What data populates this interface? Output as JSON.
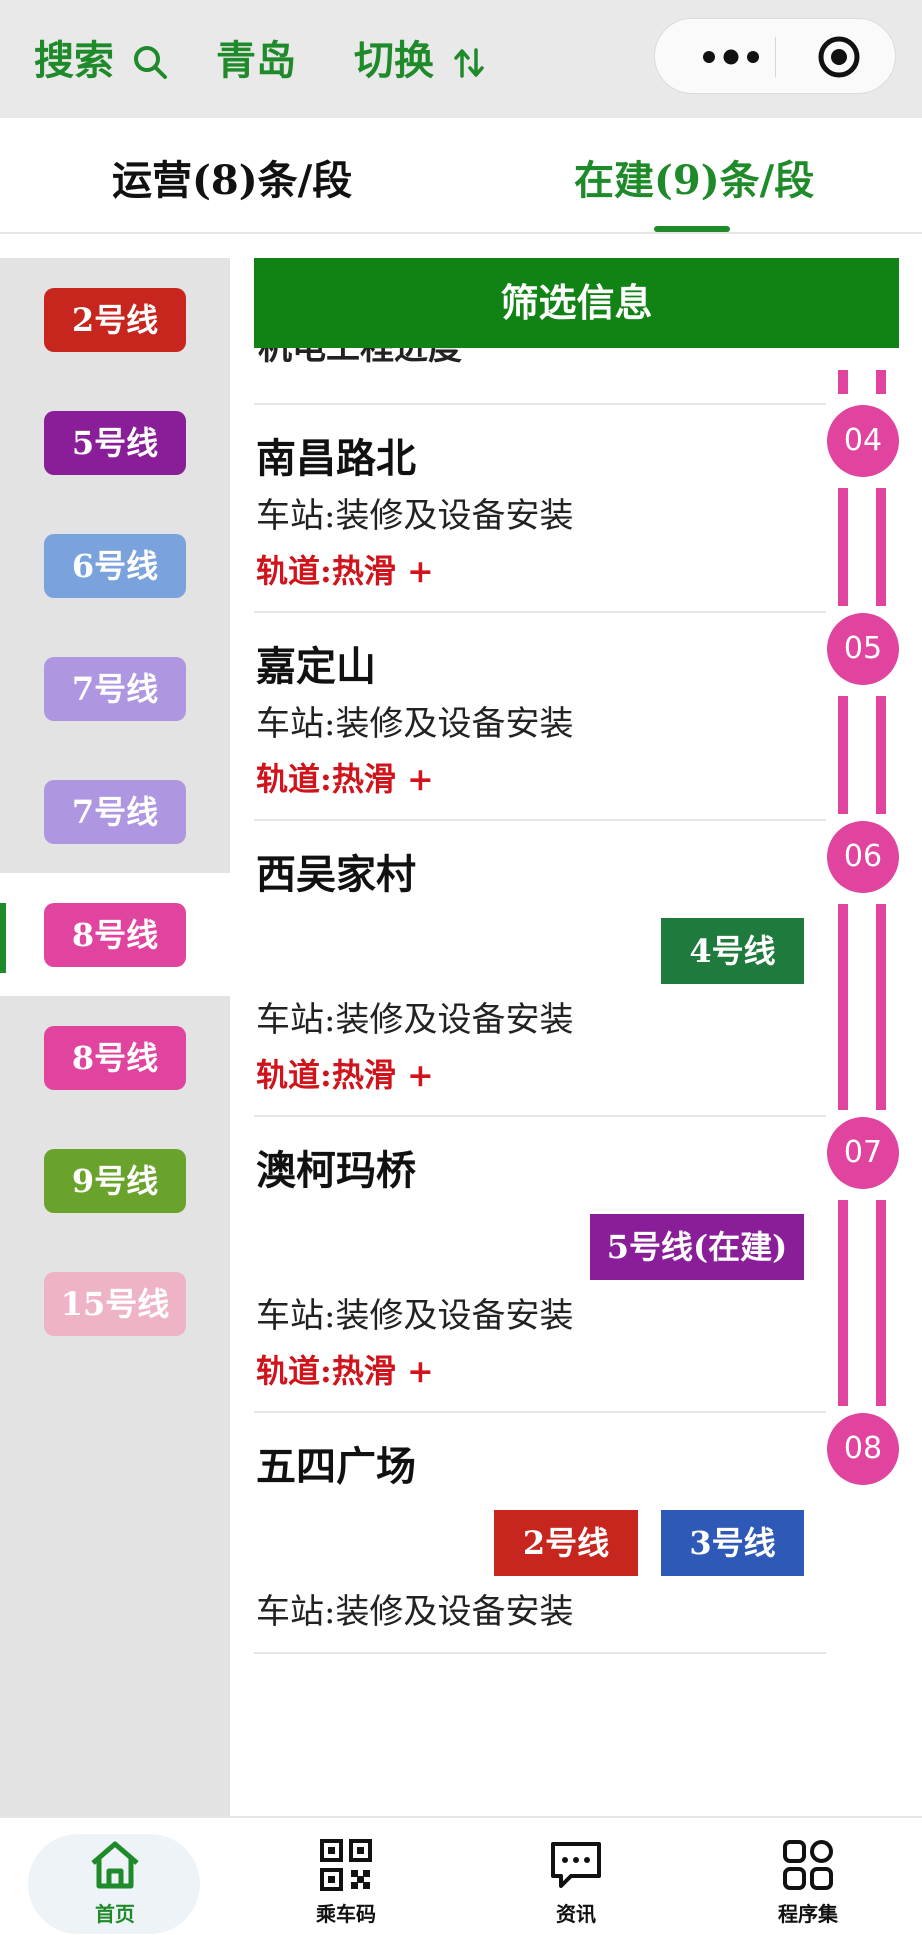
{
  "header": {
    "search_label": "搜索",
    "city_label": "青岛",
    "switch_label": "切换",
    "brand_color": "#1f8a2a"
  },
  "tabs": [
    {
      "label": "运营(8)条/段",
      "active": false
    },
    {
      "label": "在建(9)条/段",
      "active": true
    }
  ],
  "sidebar": {
    "items": [
      {
        "label": "2号线",
        "color": "#c7261e"
      },
      {
        "label": "5号线",
        "color": "#8a1e98"
      },
      {
        "label": "6号线",
        "color": "#7aa2dc"
      },
      {
        "label": "7号线",
        "color": "#ae96e0"
      },
      {
        "label": "7号线",
        "color": "#ae96e0"
      },
      {
        "label": "8号线",
        "color": "#e0449e",
        "active": true
      },
      {
        "label": "8号线",
        "color": "#e0449e"
      },
      {
        "label": "9号线",
        "color": "#6aa32c"
      },
      {
        "label": "15号线",
        "color": "#efb3c6"
      }
    ]
  },
  "filter_label": "筛选信息",
  "partial_top_text": "机电工程进度",
  "stations": [
    {
      "number": "04",
      "name": "南昌路北",
      "status": "车站:装修及设备安装",
      "track": "轨道:热滑 +",
      "transfers": []
    },
    {
      "number": "05",
      "name": "嘉定山",
      "status": "车站:装修及设备安装",
      "track": "轨道:热滑 +",
      "transfers": []
    },
    {
      "number": "06",
      "name": "西吴家村",
      "status": "车站:装修及设备安装",
      "track": "轨道:热滑 +",
      "transfers": [
        {
          "label": "4号线",
          "color": "#1f7a3e"
        }
      ]
    },
    {
      "number": "07",
      "name": "澳柯玛桥",
      "status": "车站:装修及设备安装",
      "track": "轨道:热滑 +",
      "transfers": [
        {
          "label": "5号线(在建)",
          "color": "#8a1e98"
        }
      ]
    },
    {
      "number": "08",
      "name": "五四广场",
      "status": "车站:装修及设备安装",
      "track": "",
      "transfers": [
        {
          "label": "2号线",
          "color": "#c7261e"
        },
        {
          "label": "3号线",
          "color": "#2f59b7"
        }
      ]
    }
  ],
  "line_color": "#e0449e",
  "bottom_nav": [
    {
      "label": "首页",
      "icon": "home-icon",
      "active": true
    },
    {
      "label": "乘车码",
      "icon": "qr-code-icon"
    },
    {
      "label": "资讯",
      "icon": "message-icon"
    },
    {
      "label": "程序集",
      "icon": "apps-grid-icon"
    }
  ]
}
